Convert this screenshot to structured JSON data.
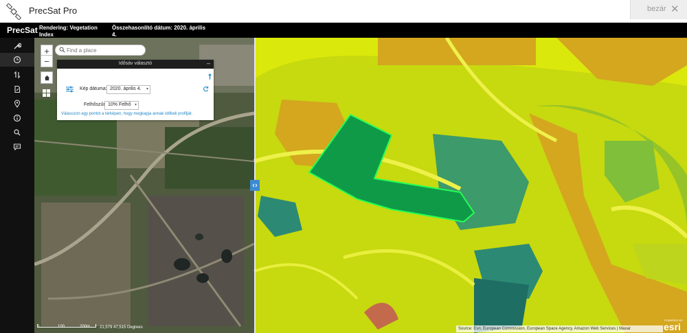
{
  "app": {
    "title": "PrecSat Pro",
    "close_label": "bezár"
  },
  "header": {
    "brand": "PrecSat",
    "rendering_line1": "Rendering: Vegetation",
    "rendering_line2": "Index",
    "compare_line1": "Összehasonlító dátum: 2020. április",
    "compare_line2": "4."
  },
  "sidebar": {
    "items": [
      {
        "icon": "wrench-icon"
      },
      {
        "icon": "clock-icon"
      },
      {
        "icon": "swap-vertical-icon"
      },
      {
        "icon": "document-edit-icon"
      },
      {
        "icon": "location-pin-icon"
      },
      {
        "icon": "info-icon"
      },
      {
        "icon": "search-icon"
      },
      {
        "icon": "chat-icon"
      }
    ]
  },
  "map": {
    "zoom_in": "+",
    "zoom_out": "−",
    "search_placeholder": "Find a place",
    "scale_left": "0",
    "scale_mid": "100",
    "scale_right": "200m",
    "coords": "21,579 47,515 Degrees",
    "attribution": "Source: Esri, European Commission, European Space Agency, Amazon Web Services | Maxar",
    "esri_text": "esri",
    "esri_powered": "POWERED BY"
  },
  "panel": {
    "title": "Idősáv választó",
    "date_label": "Kép dátuma:",
    "date_value": "2020. április 4.",
    "cloud_label": "Felhőszűrő:",
    "cloud_value": "10% Felhő",
    "hint": "Válasszon egy pontot a térképen, hogy megkapja annak időbeli profilját."
  },
  "colors": {
    "accent": "#3d8bd0",
    "hint_blue": "#1f86c8",
    "field_highlight": "#00ff44"
  }
}
